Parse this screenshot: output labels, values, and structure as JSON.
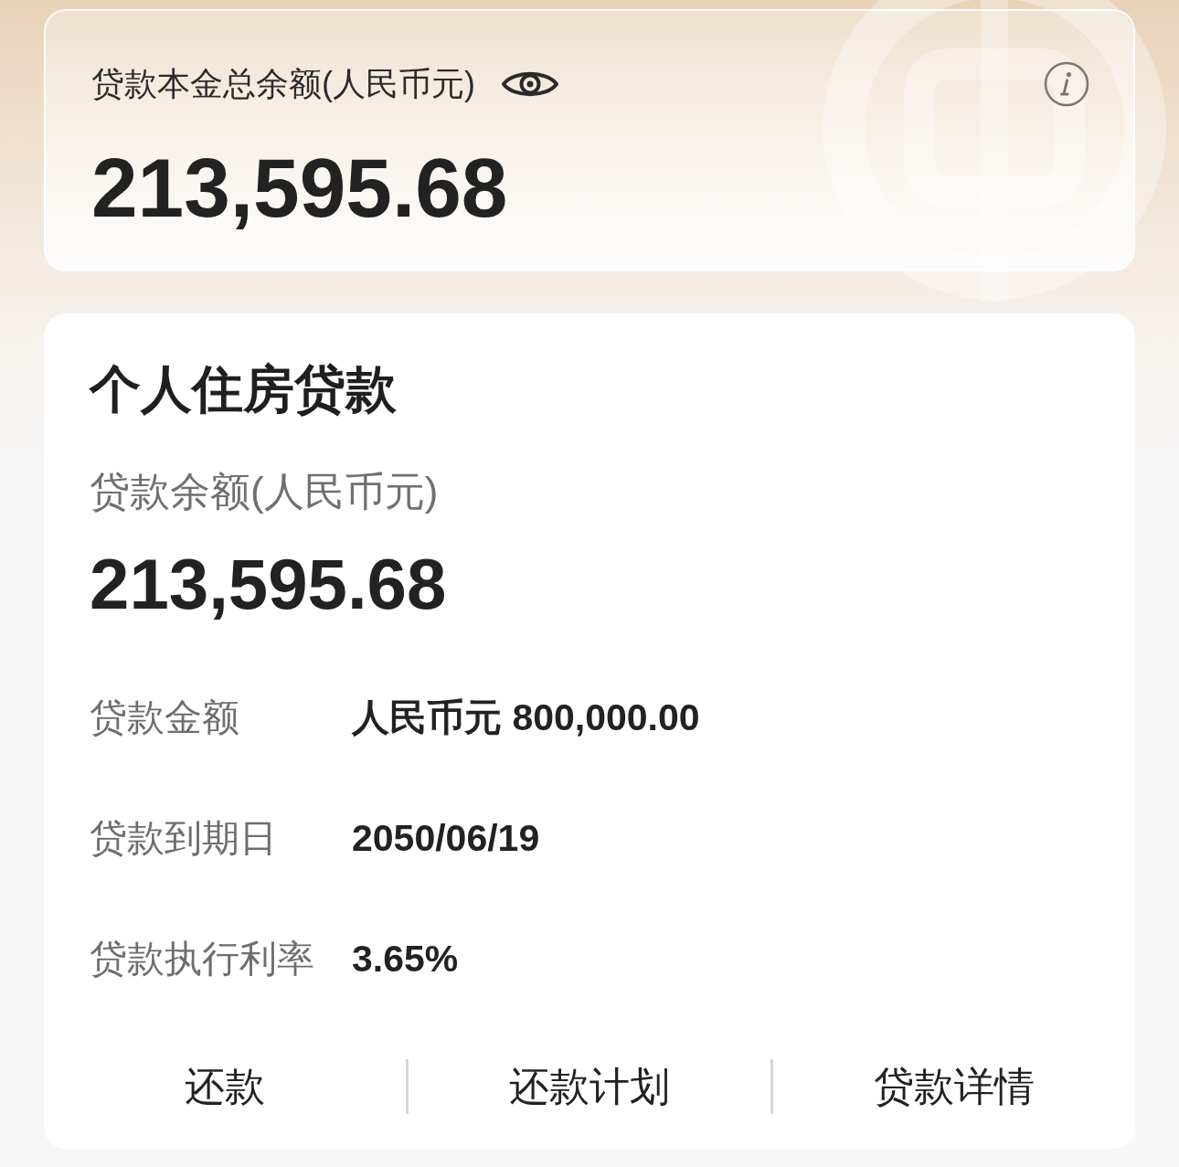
{
  "summary": {
    "label": "贷款本金总余额(人民币元)",
    "amount": "213,595.68"
  },
  "loan": {
    "title": "个人住房贷款",
    "balance_label": "贷款余额(人民币元)",
    "balance": "213,595.68",
    "details": [
      {
        "label": "贷款金额",
        "value": "人民币元 800,000.00"
      },
      {
        "label": "贷款到期日",
        "value": "2050/06/19"
      },
      {
        "label": "贷款执行利率",
        "value": "3.65%"
      }
    ],
    "actions": [
      "还款",
      "还款计划",
      "贷款详情"
    ]
  }
}
